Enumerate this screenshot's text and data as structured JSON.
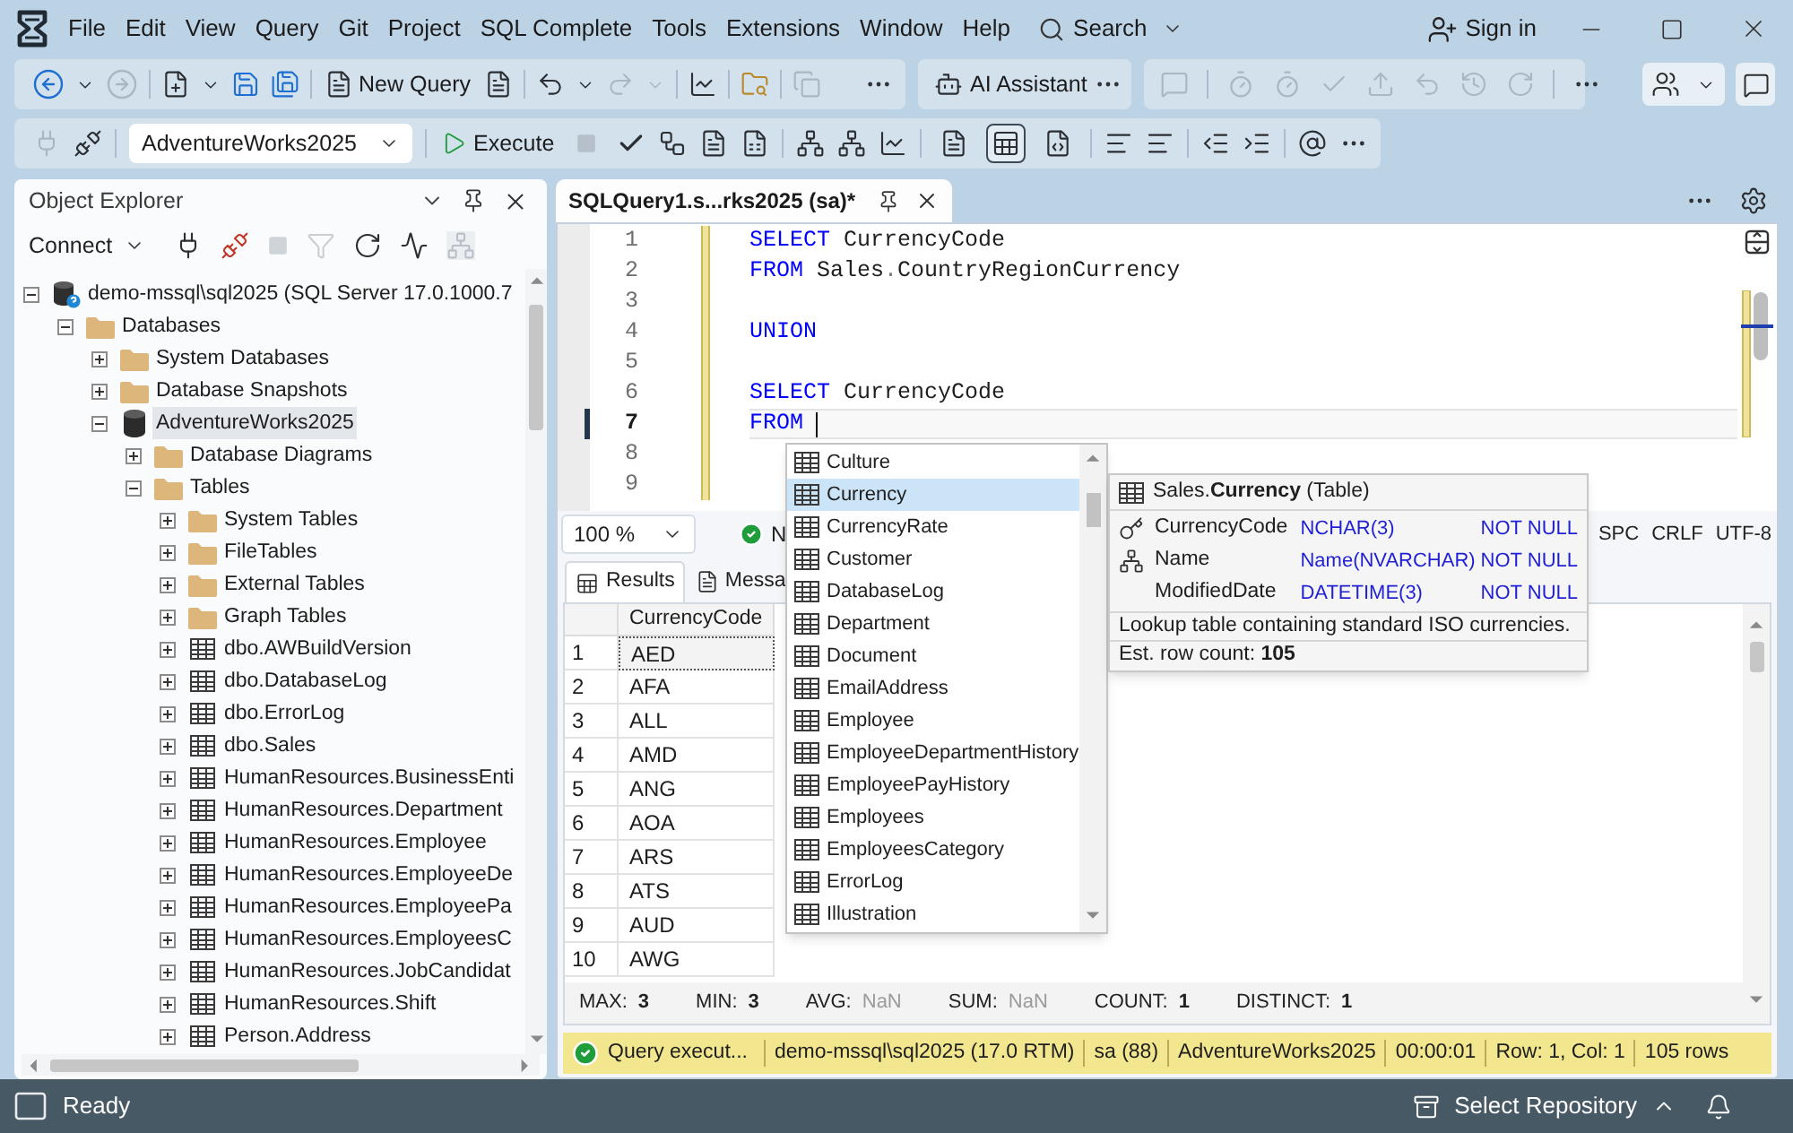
{
  "menu_bar": {
    "items": [
      "File",
      "Edit",
      "View",
      "Query",
      "Git",
      "Project",
      "SQL Complete",
      "Tools",
      "Extensions",
      "Window",
      "Help"
    ],
    "search": "Search",
    "sign_in": "Sign in"
  },
  "toolbar": {
    "new_query": "New Query",
    "ai_assistant": "AI Assistant",
    "database": "AdventureWorks2025",
    "execute": "Execute",
    "results_output": [
      {
        "selected": false
      },
      {
        "selected": true
      },
      {
        "selected": false
      }
    ]
  },
  "object_explorer": {
    "title": "Object Explorer",
    "connect": "Connect",
    "tree": [
      {
        "label": "demo-mssql\\sql2025 (SQL Server 17.0.1000.7",
        "kind": "server",
        "expanded": true,
        "selected": false,
        "children": [
          {
            "label": "Databases",
            "kind": "folder",
            "expanded": true,
            "selected": false,
            "children": [
              {
                "label": "System Databases",
                "kind": "folder",
                "expanded": false,
                "selected": false
              },
              {
                "label": "Database Snapshots",
                "kind": "folder",
                "expanded": false,
                "selected": false
              },
              {
                "label": "AdventureWorks2025",
                "kind": "database",
                "expanded": true,
                "selected": true,
                "children": [
                  {
                    "label": "Database Diagrams",
                    "kind": "folder",
                    "expanded": false,
                    "selected": false
                  },
                  {
                    "label": "Tables",
                    "kind": "folder",
                    "expanded": true,
                    "selected": false,
                    "children": [
                      {
                        "label": "System Tables",
                        "kind": "folder",
                        "expanded": false,
                        "selected": false
                      },
                      {
                        "label": "FileTables",
                        "kind": "folder",
                        "expanded": false,
                        "selected": false
                      },
                      {
                        "label": "External Tables",
                        "kind": "folder",
                        "expanded": false,
                        "selected": false
                      },
                      {
                        "label": "Graph Tables",
                        "kind": "folder",
                        "expanded": false,
                        "selected": false
                      },
                      {
                        "label": "dbo.AWBuildVersion",
                        "kind": "table",
                        "expanded": false,
                        "selected": false
                      },
                      {
                        "label": "dbo.DatabaseLog",
                        "kind": "table",
                        "expanded": false,
                        "selected": false
                      },
                      {
                        "label": "dbo.ErrorLog",
                        "kind": "table",
                        "expanded": false,
                        "selected": false
                      },
                      {
                        "label": "dbo.Sales",
                        "kind": "table",
                        "expanded": false,
                        "selected": false
                      },
                      {
                        "label": "HumanResources.BusinessEnti",
                        "kind": "table",
                        "expanded": false,
                        "selected": false
                      },
                      {
                        "label": "HumanResources.Department",
                        "kind": "table",
                        "expanded": false,
                        "selected": false
                      },
                      {
                        "label": "HumanResources.Employee",
                        "kind": "table",
                        "expanded": false,
                        "selected": false
                      },
                      {
                        "label": "HumanResources.EmployeeDe",
                        "kind": "table",
                        "expanded": false,
                        "selected": false
                      },
                      {
                        "label": "HumanResources.EmployeePa",
                        "kind": "table",
                        "expanded": false,
                        "selected": false
                      },
                      {
                        "label": "HumanResources.EmployeesC",
                        "kind": "table",
                        "expanded": false,
                        "selected": false
                      },
                      {
                        "label": "HumanResources.JobCandidat",
                        "kind": "table",
                        "expanded": false,
                        "selected": false
                      },
                      {
                        "label": "HumanResources.Shift",
                        "kind": "table",
                        "expanded": false,
                        "selected": false
                      },
                      {
                        "label": "Person.Address",
                        "kind": "table",
                        "expanded": false,
                        "selected": false
                      }
                    ]
                  }
                ]
              }
            ]
          }
        ]
      }
    ]
  },
  "editor": {
    "tab": {
      "title": "SQLQuery1.s...rks2025 (sa)*",
      "selected": true
    },
    "lines": [
      {
        "number": "1",
        "modified": true,
        "current": false,
        "tokens": [
          {
            "text": "SELECT",
            "kind": "keyword"
          },
          {
            "text": " CurrencyCode",
            "kind": "identifier"
          }
        ]
      },
      {
        "number": "2",
        "modified": true,
        "current": false,
        "tokens": [
          {
            "text": "FROM",
            "kind": "keyword"
          },
          {
            "text": " Sales",
            "kind": "identifier"
          },
          {
            "text": ".",
            "kind": "operator"
          },
          {
            "text": "CountryRegionCurrency",
            "kind": "identifier"
          }
        ]
      },
      {
        "number": "3",
        "modified": true,
        "current": false
      },
      {
        "number": "4",
        "modified": true,
        "current": false,
        "tokens": [
          {
            "text": "UNION",
            "kind": "keyword"
          }
        ]
      },
      {
        "number": "5",
        "modified": true,
        "current": false
      },
      {
        "number": "6",
        "modified": true,
        "current": false,
        "tokens": [
          {
            "text": "SELECT",
            "kind": "keyword"
          },
          {
            "text": " CurrencyCode",
            "kind": "identifier"
          }
        ]
      },
      {
        "number": "7",
        "modified": true,
        "current": true,
        "tokens": [
          {
            "text": "FROM",
            "kind": "keyword"
          }
        ]
      },
      {
        "number": "8",
        "modified": true,
        "current": false
      },
      {
        "number": "9",
        "modified": true,
        "current": false
      }
    ],
    "zoom": "100 %",
    "status": {
      "text": "N",
      "success": true
    },
    "indicators": [
      "SPC",
      "CRLF",
      "UTF-8"
    ]
  },
  "autocomplete": {
    "items": [
      {
        "label": "Culture",
        "selected": false
      },
      {
        "label": "Currency",
        "selected": true
      },
      {
        "label": "CurrencyRate",
        "selected": false
      },
      {
        "label": "Customer",
        "selected": false
      },
      {
        "label": "DatabaseLog",
        "selected": false
      },
      {
        "label": "Department",
        "selected": false
      },
      {
        "label": "Document",
        "selected": false
      },
      {
        "label": "EmailAddress",
        "selected": false
      },
      {
        "label": "Employee",
        "selected": false
      },
      {
        "label": "EmployeeDepartmentHistory",
        "selected": false
      },
      {
        "label": "EmployeePayHistory",
        "selected": false
      },
      {
        "label": "Employees",
        "selected": false
      },
      {
        "label": "EmployeesCategory",
        "selected": false
      },
      {
        "label": "ErrorLog",
        "selected": false
      },
      {
        "label": "Illustration",
        "selected": false
      }
    ]
  },
  "object_info": {
    "title": "Sales.**Currency** (Table)",
    "columns": [
      {
        "name": "CurrencyCode",
        "type": "NCHAR(3)",
        "nullability": "NOT NULL",
        "kind": "primary_key"
      },
      {
        "name": "Name",
        "type": "Name(NVARCHAR)",
        "nullability": "NOT NULL",
        "kind": "user_type"
      },
      {
        "name": "ModifiedDate",
        "type": "DATETIME(3)",
        "nullability": "NOT NULL",
        "kind": "plain"
      }
    ],
    "description": "Lookup table containing standard ISO currencies.",
    "row_count": "Est. row count: **105**"
  },
  "results": {
    "tabs": [
      {
        "label": "Results",
        "selected": true
      },
      {
        "label": "Messa",
        "selected": false
      }
    ],
    "columns": [
      "CurrencyCode"
    ],
    "rows": [
      {
        "number": "1",
        "cells": [
          "AED"
        ],
        "selected": true
      },
      {
        "number": "2",
        "cells": [
          "AFA"
        ],
        "selected": false
      },
      {
        "number": "3",
        "cells": [
          "ALL"
        ],
        "selected": false
      },
      {
        "number": "4",
        "cells": [
          "AMD"
        ],
        "selected": false
      },
      {
        "number": "5",
        "cells": [
          "ANG"
        ],
        "selected": false
      },
      {
        "number": "6",
        "cells": [
          "AOA"
        ],
        "selected": false
      },
      {
        "number": "7",
        "cells": [
          "ARS"
        ],
        "selected": false
      },
      {
        "number": "8",
        "cells": [
          "ATS"
        ],
        "selected": false
      },
      {
        "number": "9",
        "cells": [
          "AUD"
        ],
        "selected": false
      },
      {
        "number": "10",
        "cells": [
          "AWG"
        ],
        "selected": false
      }
    ],
    "aggregates": [
      {
        "label": "MAX:",
        "value": "3",
        "kind": "numeric"
      },
      {
        "label": "MIN:",
        "value": "3",
        "kind": "numeric"
      },
      {
        "label": "AVG:",
        "value": "NaN",
        "kind": "nan"
      },
      {
        "label": "SUM:",
        "value": "NaN",
        "kind": "nan"
      },
      {
        "label": "COUNT:",
        "value": "1",
        "kind": "numeric"
      },
      {
        "label": "DISTINCT:",
        "value": "1",
        "kind": "numeric"
      }
    ]
  },
  "query_status": {
    "success": true,
    "items": [
      "Query execut...",
      "demo-mssql\\sql2025 (17.0 RTM)",
      "sa (88)",
      "AdventureWorks2025",
      "00:00:01",
      "Row: 1, Col: 1",
      "105 rows"
    ]
  },
  "status_bar": {
    "text": "Ready",
    "repository": "Select Repository"
  }
}
